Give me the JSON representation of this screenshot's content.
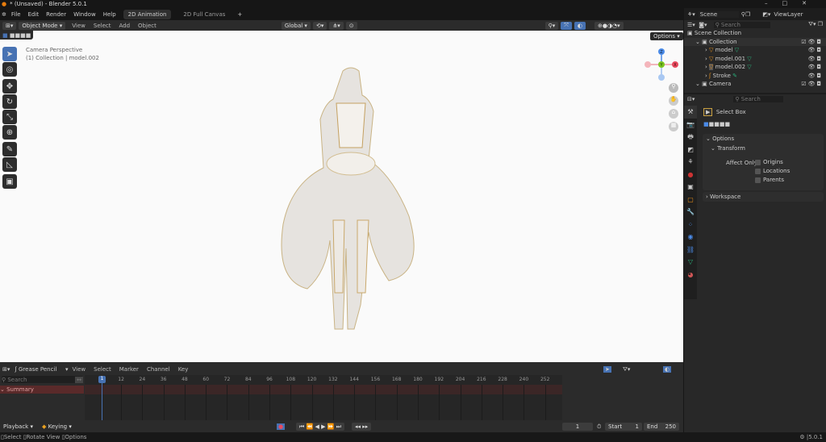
{
  "window": {
    "title": "* (Unsaved) - Blender 5.0.1"
  },
  "menu": {
    "items": [
      "File",
      "Edit",
      "Render",
      "Window",
      "Help"
    ],
    "workspaces": [
      "2D Animation",
      "2D Full Canvas"
    ],
    "add_tab": "+"
  },
  "viewport_header": {
    "mode": "Object Mode",
    "menus": [
      "View",
      "Select",
      "Add",
      "Object"
    ],
    "orientation": "Global",
    "options": "Options"
  },
  "viewport": {
    "camera_label": "Camera Perspective",
    "collection_label": "(1) Collection | model.002",
    "gizmo": {
      "z": "Z",
      "y": "Y",
      "x": "X"
    }
  },
  "top_right": {
    "scene": "Scene",
    "view_layer": "ViewLayer",
    "search_placeholder": "Search"
  },
  "outliner": {
    "root": "Scene Collection",
    "items": [
      {
        "label": "Collection",
        "depth": 0
      },
      {
        "label": "model",
        "depth": 1
      },
      {
        "label": "model.001",
        "depth": 1
      },
      {
        "label": "model.002",
        "depth": 1
      },
      {
        "label": "Stroke",
        "depth": 1
      },
      {
        "label": "Camera",
        "depth": 0
      }
    ]
  },
  "properties": {
    "search_placeholder": "Search",
    "tool": "Select Box",
    "options": "Options",
    "transform": "Transform",
    "affect_only": "Affect Only",
    "checks": [
      "Origins",
      "Locations",
      "Parents"
    ],
    "workspace": "Workspace"
  },
  "timeline": {
    "editor": "Grease Pencil",
    "menus": [
      "View",
      "Select",
      "Marker",
      "Channel",
      "Key"
    ],
    "search_placeholder": "Search",
    "summary": "Summary",
    "ticks": [
      "1",
      "12",
      "24",
      "36",
      "48",
      "60",
      "72",
      "84",
      "96",
      "108",
      "120",
      "132",
      "144",
      "156",
      "168",
      "180",
      "192",
      "204",
      "216",
      "228",
      "240",
      "252"
    ],
    "current_frame": "1",
    "start_label": "Start",
    "start": "1",
    "end_label": "End",
    "end": "250",
    "playback": "Playback",
    "keying": "Keying"
  },
  "status": {
    "items": [
      "Select",
      "Rotate View",
      "Options"
    ],
    "version": "5.0.1"
  },
  "colors": {
    "accent": "#4772b3",
    "summary": "#5a2a2a"
  }
}
